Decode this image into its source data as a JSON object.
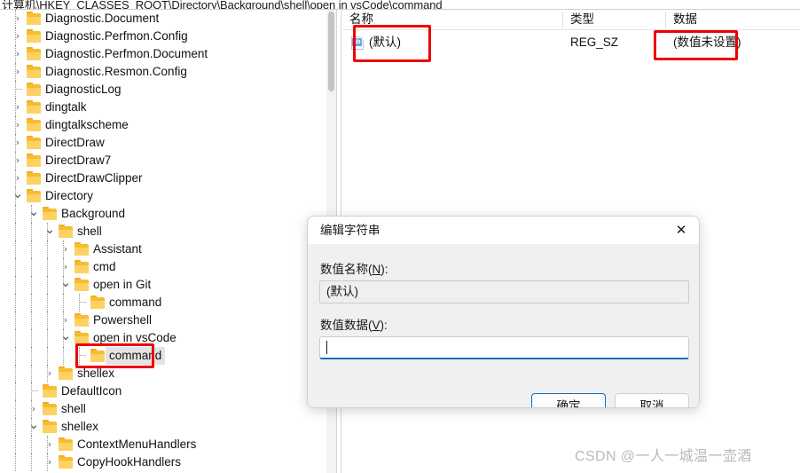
{
  "window": {
    "address_path": "计算机\\HKEY_CLASSES_ROOT\\Directory\\Background\\shell\\open in vsCode\\command"
  },
  "tree": {
    "items": [
      {
        "label": "Diagnostic.Document",
        "depth": 0,
        "state": "collapsed"
      },
      {
        "label": "Diagnostic.Perfmon.Config",
        "depth": 0,
        "state": "collapsed"
      },
      {
        "label": "Diagnostic.Perfmon.Document",
        "depth": 0,
        "state": "collapsed"
      },
      {
        "label": "Diagnostic.Resmon.Config",
        "depth": 0,
        "state": "collapsed"
      },
      {
        "label": "DiagnosticLog",
        "depth": 0,
        "state": "leaf"
      },
      {
        "label": "dingtalk",
        "depth": 0,
        "state": "collapsed"
      },
      {
        "label": "dingtalkscheme",
        "depth": 0,
        "state": "collapsed"
      },
      {
        "label": "DirectDraw",
        "depth": 0,
        "state": "collapsed"
      },
      {
        "label": "DirectDraw7",
        "depth": 0,
        "state": "collapsed"
      },
      {
        "label": "DirectDrawClipper",
        "depth": 0,
        "state": "collapsed"
      },
      {
        "label": "Directory",
        "depth": 0,
        "state": "expanded"
      },
      {
        "label": "Background",
        "depth": 1,
        "state": "expanded"
      },
      {
        "label": "shell",
        "depth": 2,
        "state": "expanded"
      },
      {
        "label": "Assistant",
        "depth": 3,
        "state": "collapsed"
      },
      {
        "label": "cmd",
        "depth": 3,
        "state": "collapsed"
      },
      {
        "label": "open in Git",
        "depth": 3,
        "state": "expanded"
      },
      {
        "label": "command",
        "depth": 4,
        "state": "leaf"
      },
      {
        "label": "Powershell",
        "depth": 3,
        "state": "collapsed"
      },
      {
        "label": "open in vsCode",
        "depth": 3,
        "state": "expanded"
      },
      {
        "label": "command",
        "depth": 4,
        "state": "leaf",
        "selected": true,
        "highlighted": true
      },
      {
        "label": "shellex",
        "depth": 2,
        "state": "collapsed"
      },
      {
        "label": "DefaultIcon",
        "depth": 1,
        "state": "leaf"
      },
      {
        "label": "shell",
        "depth": 1,
        "state": "collapsed"
      },
      {
        "label": "shellex",
        "depth": 1,
        "state": "expanded"
      },
      {
        "label": "ContextMenuHandlers",
        "depth": 2,
        "state": "collapsed"
      },
      {
        "label": "CopyHookHandlers",
        "depth": 2,
        "state": "collapsed"
      }
    ]
  },
  "values": {
    "columns": [
      "名称",
      "类型",
      "数据"
    ],
    "rows": [
      {
        "name": "(默认)",
        "type": "REG_SZ",
        "data": "(数值未设置)",
        "icon": "string-value-icon"
      }
    ]
  },
  "dialog": {
    "title": "编辑字符串",
    "close_label": "✕",
    "name_label_pre": "数值名称(",
    "name_label_key": "N",
    "name_label_post": "):",
    "name_value": "(默认)",
    "data_label_pre": "数值数据(",
    "data_label_key": "V",
    "data_label_post": "):",
    "data_value": "",
    "ok_label": "确定",
    "cancel_label": "取消"
  },
  "watermark": {
    "text": "CSDN @一人一城温一壶酒"
  },
  "colors": {
    "accent": "#0f6cbd",
    "annotation": "#ee0000",
    "folder": "#f7bc2f",
    "selection": "#e4e4e4"
  }
}
